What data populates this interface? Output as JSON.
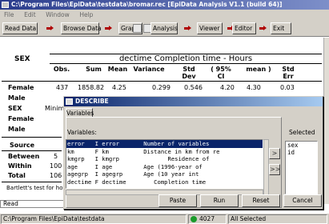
{
  "window": {
    "title": "C:\\Program Files\\EpiData\\testdata\\bromar.rec [EpiData Analysis V1.1 (build 64)]"
  },
  "menu": [
    "File",
    "Edit",
    "Window",
    "Help"
  ],
  "toolbar": {
    "read": "Read Data",
    "browse": "Browse Data",
    "graphs": "Graphs",
    "analysis": "Analysis",
    "viewer": "Viewer",
    "editor": "Editor",
    "exit": "Exit",
    "stop_icon": "stop-icon"
  },
  "output": {
    "caption": "dectime Completion time - Hours",
    "headers": {
      "sex": "SEX",
      "obs": "Obs.",
      "sum": "Sum",
      "mean": "Mean",
      "variance": "Variance",
      "std": "Std Dev",
      "ci": "( 95% CI",
      "mean2": "mean )",
      "stderr": "Std Err"
    },
    "rows": [
      {
        "label": "Female",
        "obs": "437",
        "sum": "1858.82",
        "mean": "4.25",
        "variance": "0.299",
        "std": "0.546",
        "ci_low": "4.20",
        "ci_high": "4.30",
        "stderr": "0.03"
      },
      {
        "label": "Male"
      }
    ],
    "sex2": "SEX",
    "mini": "Minim",
    "female2": "Female",
    "male2": "Male",
    "source": "Source",
    "between": "Between",
    "between_val": "5",
    "within": "Within",
    "within_val": "100",
    "total": "Total",
    "total_val": "106",
    "bartlett": "Bartlett's test for ho"
  },
  "command": "Read",
  "status": {
    "path": "C:\\Program Files\\EpiData\\testdata",
    "records": "4027",
    "selected": "All Selected"
  },
  "dialog": {
    "title": "DESCRIBE",
    "tab": "Variables",
    "variables_label": "Variables:",
    "selected_label": "Selected",
    "variables": [
      {
        "text": "error   I error       Number of variables",
        "selected": true
      },
      {
        "text": "km      F km          Distance in km from re"
      },
      {
        "text": "kmgrp   I kmgrp              Residence of"
      },
      {
        "text": "age     I age         Age (1996-year of"
      },
      {
        "text": "agegrp  I agegrp      Age (10 year int"
      },
      {
        "text": "dectime F dectime        Completion time"
      }
    ],
    "selected": [
      "sex",
      "id"
    ],
    "buttons": {
      "paste": "Paste",
      "run": "Run",
      "reset": "Reset",
      "cancel": "Cancel"
    },
    "move_one": ">",
    "move_all": ">>"
  }
}
